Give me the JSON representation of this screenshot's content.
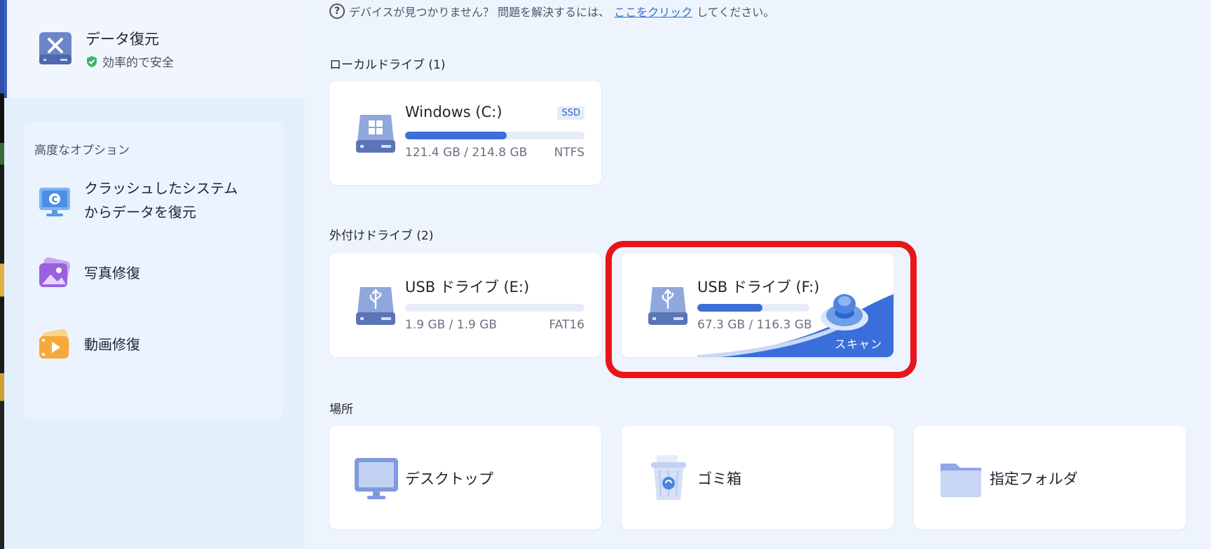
{
  "sidebar": {
    "app_title": "データ復元",
    "app_subtitle": "効率的で安全",
    "advanced_title": "高度なオプション",
    "items": [
      {
        "label_line1": "クラッシュしたシステム",
        "label_line2": "からデータを復元",
        "icon": "crashed-system-icon"
      },
      {
        "label": "写真修復",
        "icon": "photo-repair-icon"
      },
      {
        "label": "動画修復",
        "icon": "video-repair-icon"
      }
    ]
  },
  "main": {
    "help_text": "デバイスが見つかりません？ 問題を解決するには、",
    "help_link": "ここをクリック",
    "help_suffix": "してください。",
    "local_section": "ローカルドライブ (1)",
    "external_section": "外付けドライブ (2)",
    "location_section": "場所",
    "local_drives": [
      {
        "name": "Windows (C:)",
        "badge": "SSD",
        "size": "121.4 GB / 214.8 GB",
        "fs": "NTFS",
        "used_fraction": 0.565
      }
    ],
    "external_drives": [
      {
        "name": "USB ドライブ (E:)",
        "size": "1.9 GB / 1.9 GB",
        "fs": "FAT16",
        "used_fraction": 0.0
      },
      {
        "name": "USB ドライブ (F:)",
        "size": "67.3 GB / 116.3 GB",
        "fs": "",
        "used_fraction": 0.579,
        "scan_label": "スキャン"
      }
    ],
    "locations": [
      {
        "name": "デスクトップ",
        "icon": "desktop-icon"
      },
      {
        "name": "ゴミ箱",
        "icon": "recycle-bin-icon"
      },
      {
        "name": "指定フォルダ",
        "icon": "folder-icon"
      }
    ]
  },
  "colors": {
    "accent": "#3f6ed8",
    "highlight": "#e8161b",
    "background": "#eef4fd"
  }
}
